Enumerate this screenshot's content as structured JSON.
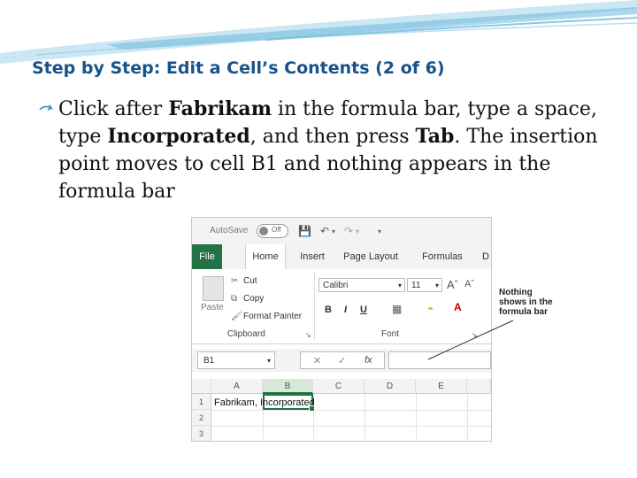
{
  "slide": {
    "title": "Step by Step: Edit a Cell’s Contents (2 of 6)",
    "bullet": {
      "t1": "Click after ",
      "b1": "Fabrikam",
      "t2": " in the formula bar, type a space, type ",
      "b2": "Incorporated",
      "t3": ", and then press ",
      "b3": "Tab",
      "t4": ". The insertion point moves to cell B1 and nothing appears in the formula bar"
    }
  },
  "excel": {
    "quick_access": {
      "autosave": "AutoSave",
      "toggle": "Off",
      "icons": [
        "save-icon",
        "undo-icon",
        "redo-icon",
        "customize-icon"
      ]
    },
    "tabs": [
      "File",
      "Home",
      "Insert",
      "Page Layout",
      "Formulas",
      "D"
    ],
    "clipboard": {
      "paste": "Paste",
      "cut": "Cut",
      "copy": "Copy",
      "format_painter": "Format Painter",
      "group": "Clipboard"
    },
    "font": {
      "name": "Calibri",
      "size": "11",
      "bold": "B",
      "italic": "I",
      "underline": "U",
      "group": "Font"
    },
    "formula_bar": {
      "name_box": "B1",
      "fx": "fx",
      "value": ""
    },
    "grid": {
      "columns": [
        "A",
        "B",
        "C",
        "D",
        "E"
      ],
      "rows": [
        "1",
        "2",
        "3"
      ],
      "a1": "Fabrikam, Incorporated"
    }
  },
  "callout": {
    "line1": "Nothing",
    "line2": "shows in the",
    "line3": "formula bar"
  },
  "colors": {
    "title": "#17538a",
    "excel_green": "#217346",
    "swoosh": "#7fc3e0"
  }
}
